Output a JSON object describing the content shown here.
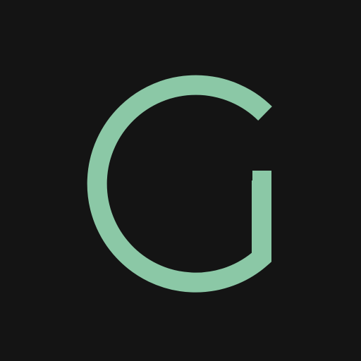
{
  "logo": {
    "letter": "G",
    "icon": "letter-g-monogram-icon",
    "colors": {
      "background": "#141414",
      "glyph": "#8BC8A6"
    }
  }
}
